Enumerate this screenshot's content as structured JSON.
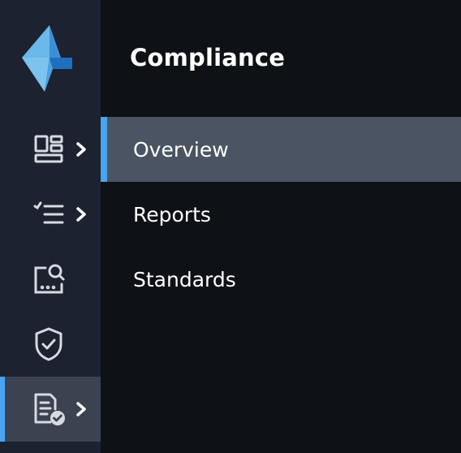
{
  "brand": {
    "logo_icon": "brand-logo-icon",
    "accent": "#4aa3f0"
  },
  "rail": {
    "items": [
      {
        "icon": "dashboard-layout-icon",
        "has_submenu": true,
        "active": false
      },
      {
        "icon": "checklist-icon",
        "has_submenu": true,
        "active": false
      },
      {
        "icon": "inspect-search-icon",
        "has_submenu": false,
        "active": false
      },
      {
        "icon": "shield-check-icon",
        "has_submenu": false,
        "active": false
      },
      {
        "icon": "compliance-document-icon",
        "has_submenu": true,
        "active": true
      }
    ]
  },
  "panel": {
    "title": "Compliance",
    "items": [
      {
        "label": "Overview",
        "active": true
      },
      {
        "label": "Reports",
        "active": false
      },
      {
        "label": "Standards",
        "active": false
      }
    ]
  },
  "colors": {
    "rail_bg": "#1d2230",
    "panel_bg": "#0e1116",
    "active_panel_bg": "#4a5462",
    "active_rail_bg": "#3b4350",
    "icon": "#d7dbe0"
  }
}
